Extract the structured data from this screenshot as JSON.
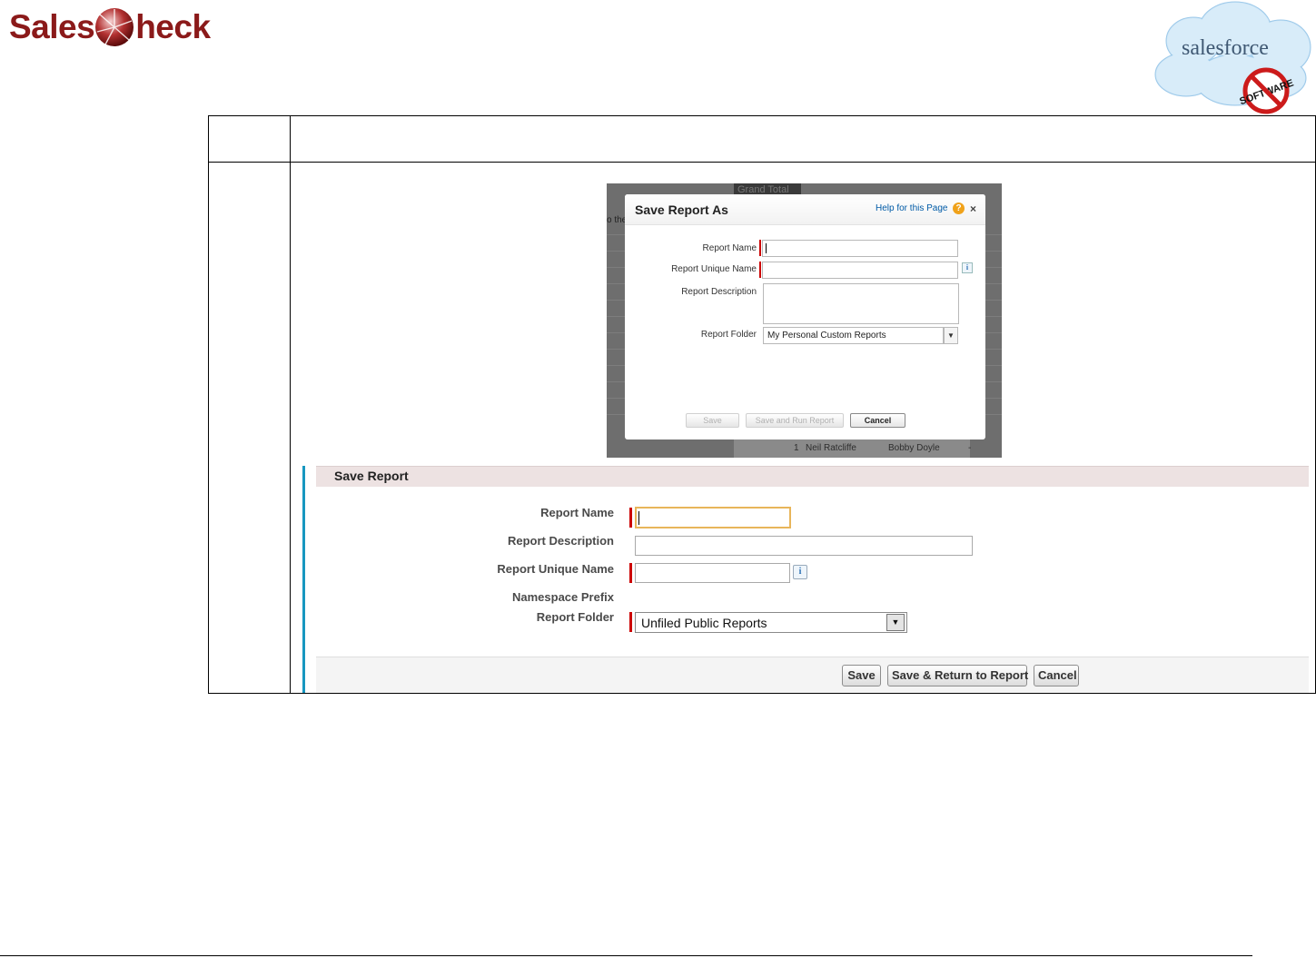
{
  "branding": {
    "left_logo_text_1": "Sales",
    "left_logo_text_2": "heck",
    "right_logo_text": "salesforce",
    "right_badge_text": "SOFTWARE"
  },
  "dialog": {
    "title": "Save Report As",
    "help_link": "Help for this Page",
    "help_icon": "?",
    "close": "×",
    "fields": {
      "report_name_label": "Report Name",
      "report_unique_name_label": "Report Unique Name",
      "report_description_label": "Report Description",
      "report_folder_label": "Report Folder",
      "report_folder_value": "My Personal Custom Reports"
    },
    "info_icon": "i",
    "buttons": {
      "save": "Save",
      "save_and_run": "Save and Run Report",
      "cancel": "Cancel"
    },
    "background": {
      "grand_total": "Grand Total",
      "the_text": "o the",
      "row_number": "1",
      "row_name_1": "Neil Ratcliffe",
      "row_name_2": "Bobby Doyle",
      "row_dash": "-"
    }
  },
  "save_form": {
    "title": "Save Report",
    "labels": {
      "report_name": "Report Name",
      "report_description": "Report Description",
      "report_unique_name": "Report Unique Name",
      "namespace_prefix": "Namespace Prefix",
      "report_folder": "Report Folder"
    },
    "report_folder_value": "Unfiled Public Reports",
    "info_icon": "i",
    "buttons": {
      "save": "Save",
      "save_return": "Save & Return to Report",
      "cancel": "Cancel"
    }
  },
  "colors": {
    "brand_red": "#8b1a1a",
    "required_marker": "#cc0000",
    "accent_blue": "#1797c0",
    "form_title_bg": "#ede2e2"
  }
}
